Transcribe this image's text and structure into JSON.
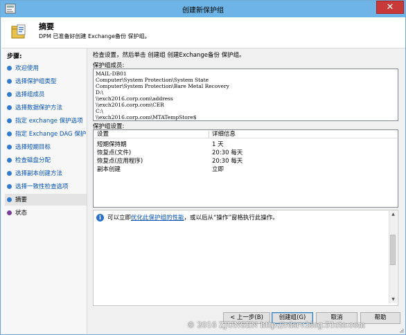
{
  "window": {
    "title": "创建新保护组",
    "close_glyph": "✕"
  },
  "header": {
    "title": "摘要",
    "description": "DPM 已准备好创建 Exchange备份 保护组。",
    "icon": "protection-group-icon"
  },
  "steps": {
    "title": "步骤:",
    "items": [
      {
        "label": "欢迎使用"
      },
      {
        "label": "选择保护组类型"
      },
      {
        "label": "选择组成员"
      },
      {
        "label": "选择数据保护方法"
      },
      {
        "label": "指定 exchange 保护选项"
      },
      {
        "label": "指定 Exchange DAG 保护"
      },
      {
        "label": "选择短期目标"
      },
      {
        "label": "检查磁盘分配"
      },
      {
        "label": "选择副本创建方法"
      },
      {
        "label": "选择一致性检查选项"
      },
      {
        "label": "摘要"
      },
      {
        "label": "状态"
      }
    ]
  },
  "main": {
    "instruction": "检查设置，然后单击 创建组 创建Exchange备份 保护组。",
    "members_label": "保护组成员:",
    "members": [
      "MAIL-DB01",
      "Computer\\System Protection\\System State",
      "Computer\\System Protection\\Bare Metal Recovery",
      "D:\\",
      "\\\\exch2016.corp.com\\address",
      "\\\\exch2016.corp.com\\CER",
      "C:\\",
      "\\\\exch2016.corp.com\\MTATempStore$"
    ],
    "settings_label": "保护组设置:",
    "settings_headers": {
      "setting": "设置",
      "detail": "详细信息"
    },
    "settings_rows": [
      {
        "setting": "短期保持期",
        "detail": "1 天"
      },
      {
        "setting": "恢复点(文件)",
        "detail": "20:30 每天"
      },
      {
        "setting": "恢复点(应用程序)",
        "detail": "20:30 每天"
      },
      {
        "setting": "副本创建",
        "detail": "立即"
      }
    ],
    "info": {
      "prefix": "可以立即",
      "link": "优化此保护组的性能",
      "suffix": "，或以后从“操作”窗格执行此操作。"
    }
  },
  "buttons": {
    "back": "< 上一步(B)",
    "create": "创建组(G)",
    "cancel": "取消",
    "help": "帮助"
  },
  "watermark": "© 2016 ZJUNSEN http://rdsrv.blog.51cto.com"
}
